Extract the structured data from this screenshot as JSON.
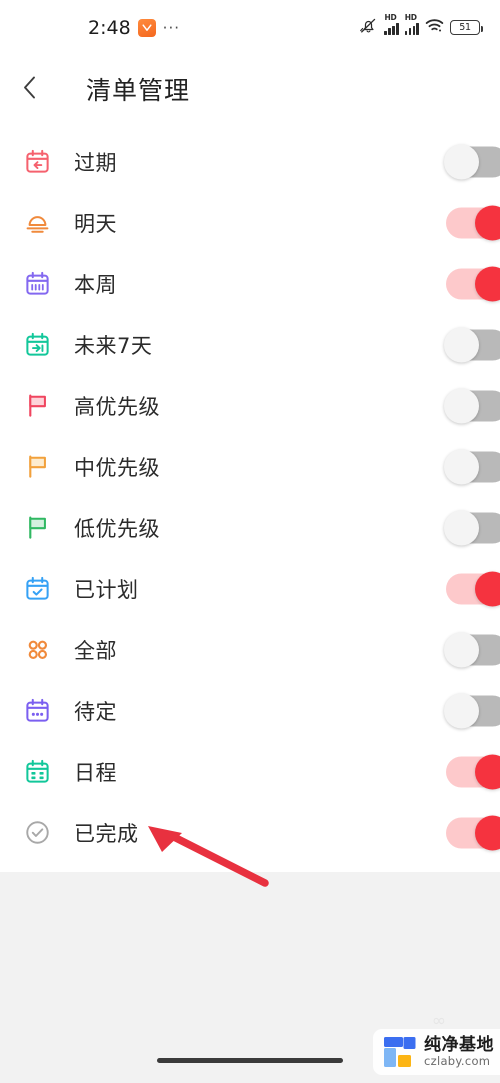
{
  "status_bar": {
    "time": "2:48",
    "app_icon": "clock-app-icon",
    "overflow_dots": "···",
    "mute_icon": "bell-muted-icon",
    "signal_1_label": "HD",
    "signal_2_label": "HD",
    "wifi_icon": "wifi-icon",
    "battery_level": "51"
  },
  "header": {
    "back_icon": "chevron-left-icon",
    "title": "清单管理"
  },
  "list": {
    "items": [
      {
        "label": "过期",
        "icon": "calendar-back-arrow-icon",
        "color": "#f5616e",
        "enabled": false
      },
      {
        "label": "明天",
        "icon": "sunrise-icon",
        "color": "#f08a3c",
        "enabled": true
      },
      {
        "label": "本周",
        "icon": "calendar-week-icon",
        "color": "#8368f0",
        "enabled": true
      },
      {
        "label": "未来7天",
        "icon": "calendar-forward-arrow-icon",
        "color": "#12c79a",
        "enabled": false
      },
      {
        "label": "高优先级",
        "icon": "flag-high-icon",
        "color": "#f0455f",
        "enabled": false
      },
      {
        "label": "中优先级",
        "icon": "flag-medium-icon",
        "color": "#f2a13c",
        "enabled": false
      },
      {
        "label": "低优先级",
        "icon": "flag-low-icon",
        "color": "#30b862",
        "enabled": false
      },
      {
        "label": "已计划",
        "icon": "calendar-check-icon",
        "color": "#35a1f5",
        "enabled": true
      },
      {
        "label": "全部",
        "icon": "grid-dots-icon",
        "color": "#f08a3c",
        "enabled": false
      },
      {
        "label": "待定",
        "icon": "calendar-dots-icon",
        "color": "#7b5ff0",
        "enabled": false
      },
      {
        "label": "日程",
        "icon": "calendar-schedule-icon",
        "color": "#12c79a",
        "enabled": true
      },
      {
        "label": "已完成",
        "icon": "check-circle-icon",
        "color": "#a8a8a8",
        "enabled": true
      }
    ]
  },
  "annotation": {
    "arrow_icon": "red-pointer-arrow",
    "arrow_color": "#e8313f"
  },
  "watermark": {
    "logo_icon": "czlaby-logo",
    "name_cn": "纯净基地",
    "name_en": "czlaby.com",
    "logo_blue": "#3b6ef0",
    "logo_lightblue": "#7eb6f5",
    "logo_yellow": "#fcb515"
  },
  "system": {
    "home_indicator": "home-indicator"
  },
  "colors": {
    "toggle_on_track": "#fdc9cb",
    "toggle_on_knob": "#f5333f",
    "toggle_off_track": "#b9b9b9",
    "toggle_off_knob": "#f4f4f4",
    "page_bg": "#f2f2f2",
    "card_bg": "#ffffff"
  }
}
